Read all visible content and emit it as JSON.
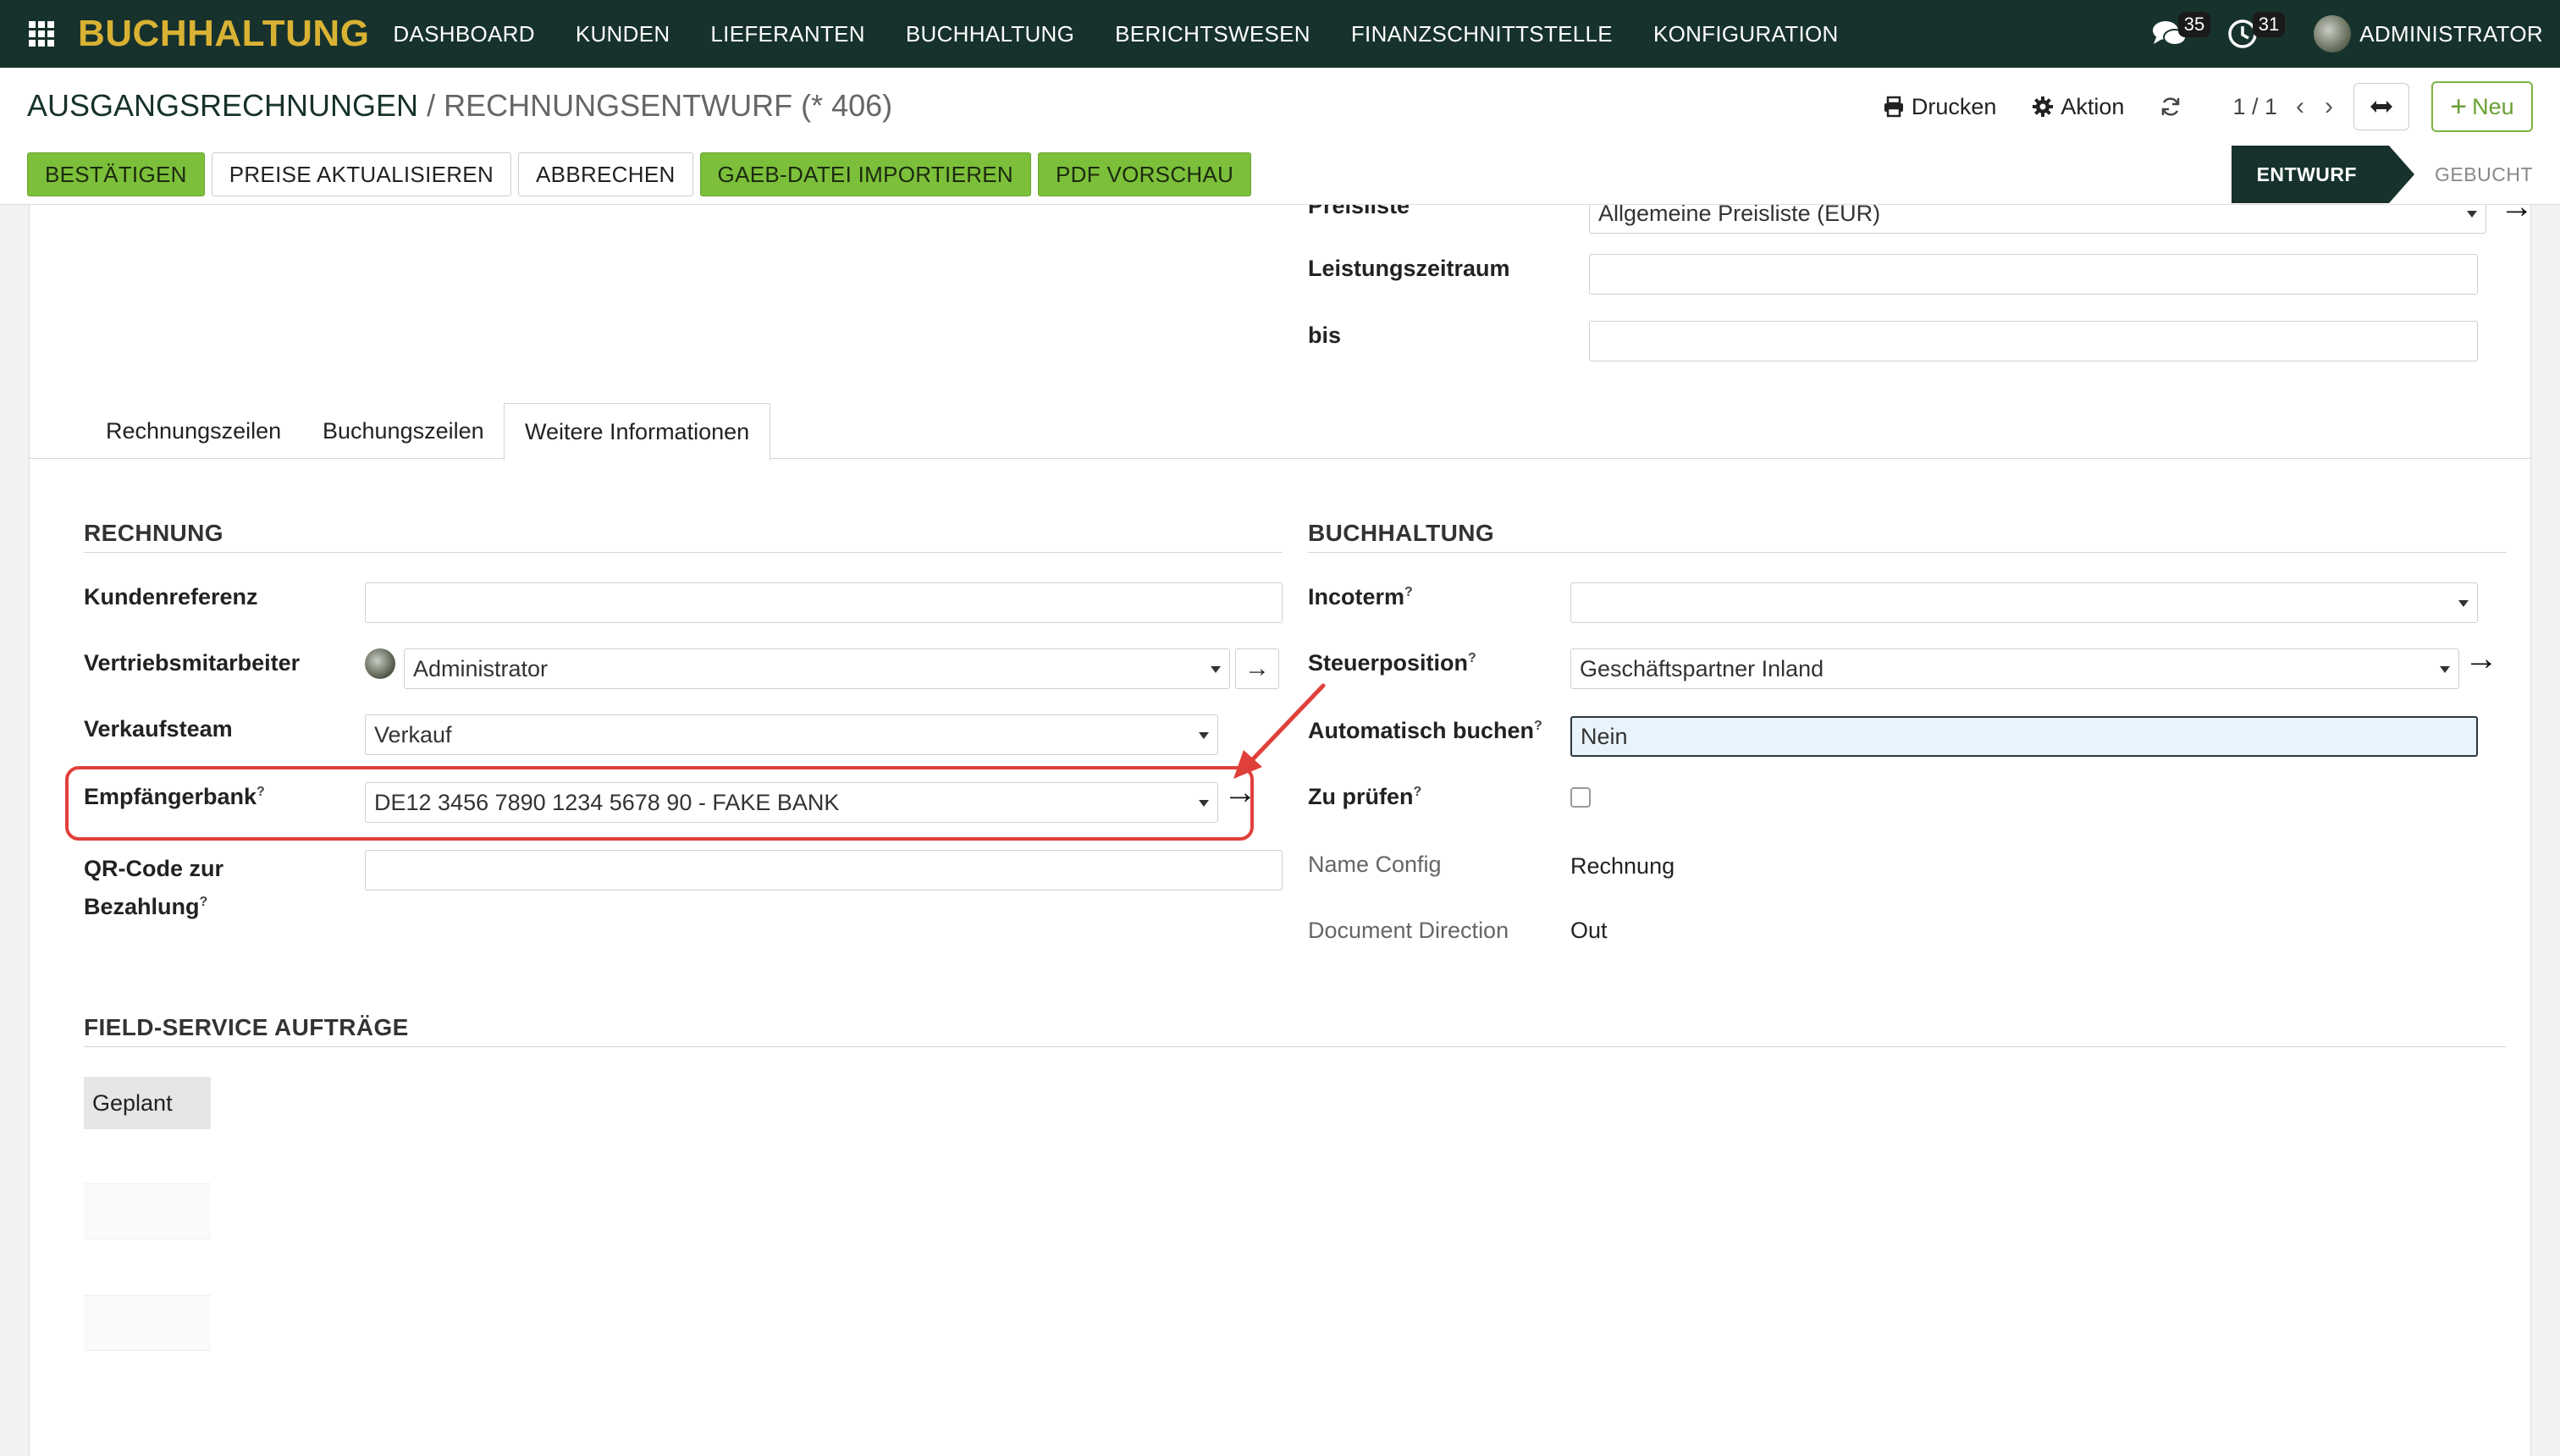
{
  "navbar": {
    "brand": "BUCHHALTUNG",
    "menu": [
      "DASHBOARD",
      "KUNDEN",
      "LIEFERANTEN",
      "BUCHHALTUNG",
      "BERICHTSWESEN",
      "FINANZSCHNITTSTELLE",
      "KONFIGURATION"
    ],
    "messages_count": "35",
    "activities_count": "31",
    "user": "ADMINISTRATOR"
  },
  "breadcrumb": {
    "root": "AUSGANGSRECHNUNGEN",
    "separator": "/",
    "current": "RECHNUNGSENTWURF (* 406)"
  },
  "control": {
    "print": "Drucken",
    "action": "Aktion",
    "pager": "1 / 1",
    "new": "Neu"
  },
  "actions": {
    "confirm": "BESTÄTIGEN",
    "update_prices": "PREISE AKTUALISIEREN",
    "cancel": "ABBRECHEN",
    "gaeb_import": "GAEB-DATEI IMPORTIEREN",
    "pdf_preview": "PDF VORSCHAU"
  },
  "status": {
    "active": "ENTWURF",
    "next": "GEBUCHT"
  },
  "top_fields": {
    "pricelist_label": "Preisliste",
    "pricelist_value": "Allgemeine Preisliste (EUR)",
    "period_label": "Leistungszeitraum",
    "to_label": "bis"
  },
  "tabs": [
    "Rechnungszeilen",
    "Buchungszeilen",
    "Weitere Informationen"
  ],
  "rechnung": {
    "title": "RECHNUNG",
    "customer_ref_label": "Kundenreferenz",
    "sales_rep_label": "Vertriebsmitarbeiter",
    "sales_rep_value": "Administrator",
    "sales_team_label": "Verkaufsteam",
    "sales_team_value": "Verkauf",
    "bank_label": "Empfängerbank",
    "bank_value": "DE12 3456 7890 1234 5678 90 - FAKE BANK",
    "qr_label_1": "QR-Code zur",
    "qr_label_2": "Bezahlung",
    "help_mark": "?"
  },
  "buchhaltung": {
    "title": "BUCHHALTUNG",
    "incoterm_label": "Incoterm",
    "fiscal_position_label": "Steuerposition",
    "fiscal_position_value": "Geschäftspartner Inland",
    "auto_post_label": "Automatisch buchen",
    "auto_post_value": "Nein",
    "to_check_label": "Zu prüfen",
    "name_config_label": "Name Config",
    "name_config_value": "Rechnung",
    "doc_direction_label": "Document Direction",
    "doc_direction_value": "Out"
  },
  "field_service": {
    "title": "FIELD-SERVICE AUFTRÄGE",
    "column": "Geplant"
  },
  "colors": {
    "navbar_bg": "#17322c",
    "brand": "#d9b234",
    "primary_green": "#7cbf3a",
    "annotation_red": "#e0403a"
  }
}
